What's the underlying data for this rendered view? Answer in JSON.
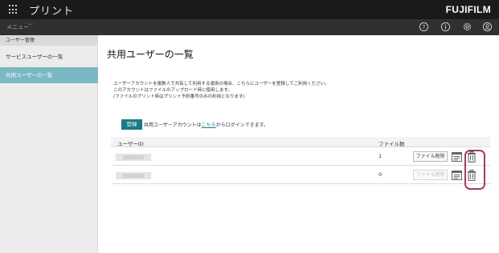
{
  "header": {
    "app_title": "プリント",
    "brand": "FUJIFILM",
    "menu_label": "メニュー",
    "icons": [
      "help-icon",
      "info-icon",
      "settings-gear-icon",
      "user-account-icon"
    ]
  },
  "sidebar": {
    "group_label": "ユーザー管理",
    "items": [
      {
        "label": "サービスユーザーの一覧",
        "active": false
      },
      {
        "label": "共用ユーザーの一覧",
        "active": true
      }
    ]
  },
  "main": {
    "title": "共用ユーザーの一覧",
    "description": [
      "ユーザーアカウントを複数人で共有して利用する運用の場合、こちらにユーザーを登録してご利用ください。",
      "このアカウントはファイルのアップロード時に使用します。",
      "(ファイルのプリント時はプリント予約番号のみの利用となります)"
    ],
    "register_button": "登録",
    "login_note_prefix": "共用ユーザーアカウントは",
    "login_note_link": "こちら",
    "login_note_suffix": "からログインできます。"
  },
  "table": {
    "columns": [
      "ユーザーID",
      "ファイル数"
    ],
    "rows": [
      {
        "file_count": "1",
        "delete_files_label": "ファイル削除",
        "delete_enabled": true
      },
      {
        "file_count": "0",
        "delete_files_label": "ファイル削除",
        "delete_enabled": false
      }
    ]
  },
  "colors": {
    "header_bg": "#1a1a1a",
    "subheader_bg": "#303030",
    "sidebar_active": "#7ab8c4",
    "accent": "#1a7a8a",
    "highlight_ring": "#a53a68"
  }
}
